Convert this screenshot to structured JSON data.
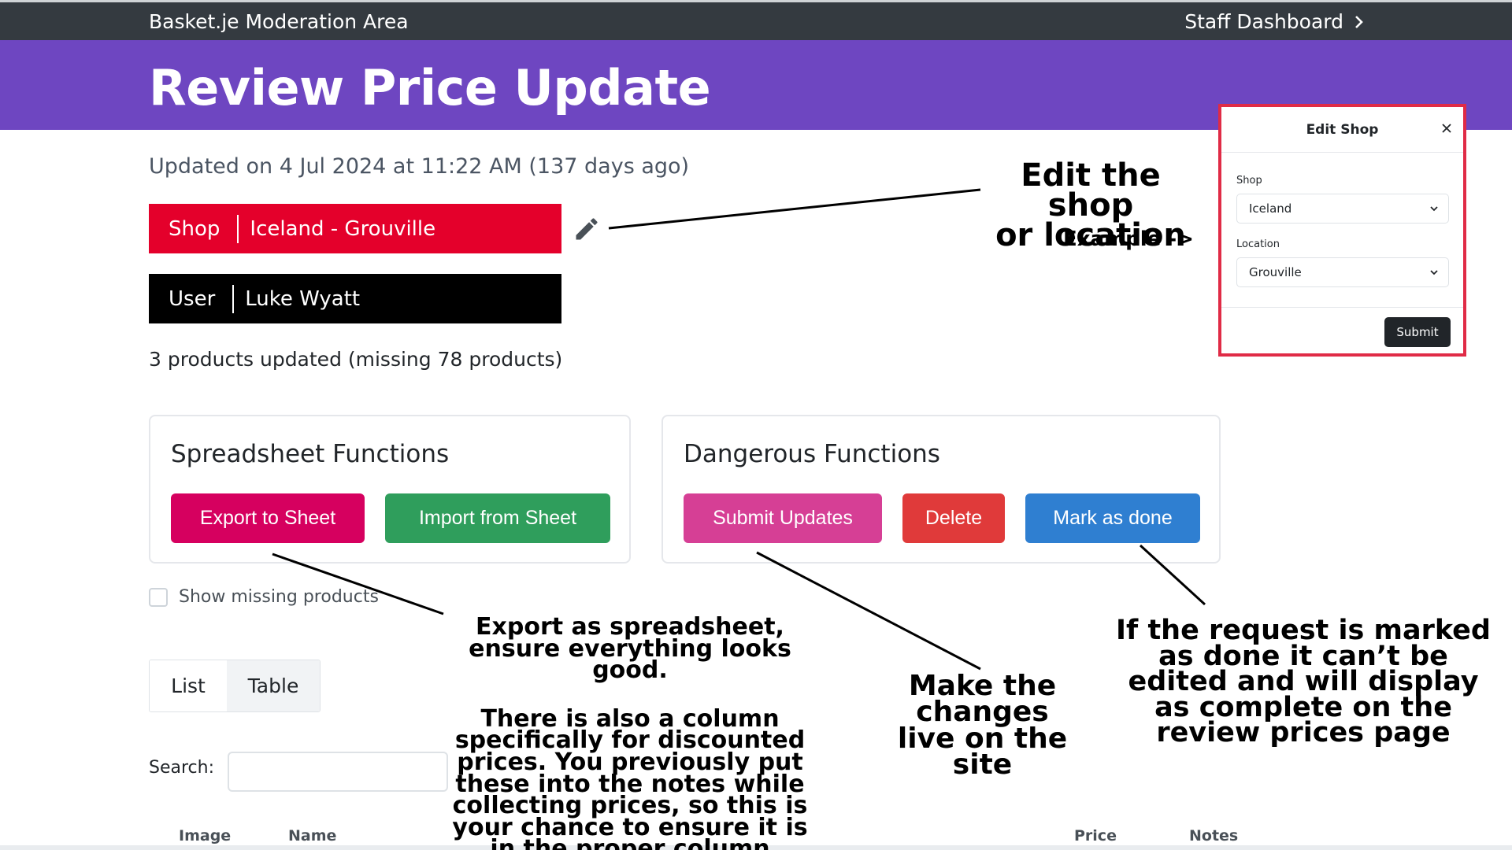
{
  "topbar": {
    "brand": "Basket.je Moderation Area",
    "staff_link": "Staff Dashboard",
    "staff_icon": "chevron-right-icon"
  },
  "page": {
    "title": "Review Price Update",
    "updated": "Updated on 4 Jul 2024 at 11:22 AM (137 days ago)",
    "shop_key": "Shop",
    "shop_value": "Iceland - Grouville",
    "user_key": "User",
    "user_value": "Luke Wyatt",
    "count": "3 products updated (missing 78 products)",
    "edit_icon": "pencil-icon"
  },
  "spreadsheet": {
    "title": "Spreadsheet Functions",
    "export_label": "Export to Sheet",
    "import_label": "Import from Sheet"
  },
  "dangerous": {
    "title": "Dangerous Functions",
    "submit_label": "Submit Updates",
    "delete_label": "Delete",
    "done_label": "Mark as done"
  },
  "filters": {
    "show_missing": "Show missing products",
    "show_missing_checked": false,
    "view_list": "List",
    "view_table": "Table",
    "active_view": "Table",
    "search_label": "Search:",
    "search_value": ""
  },
  "table": {
    "headers": [
      "Image",
      "Name",
      "Price",
      "Notes"
    ]
  },
  "modal": {
    "title": "Edit Shop",
    "shop_label": "Shop",
    "shop_value": "Iceland",
    "location_label": "Location",
    "location_value": "Grouville",
    "submit_label": "Submit"
  },
  "annotations": {
    "edit_line1": "Edit the shop",
    "edit_line2": "or location",
    "example": "Example ->",
    "export_para1": "Export as spreadsheet, ensure everything looks good.",
    "export_para2": "There is also a column specifically for discounted prices. You previously put these into the notes while collecting prices, so this is your chance to ensure it is in the proper column",
    "live": "Make the changes live on the site",
    "done": "If the request is marked as done it can’t be edited and will display as complete on the review prices page"
  },
  "colors": {
    "topbar": "#343a40",
    "hero": "#6e46c1",
    "shop_badge": "#e4002b",
    "export_btn": "#d6005f",
    "import_btn": "#2f9e5c",
    "submit_btn": "#d63f95",
    "delete_btn": "#e03a3a",
    "done_btn": "#2f7fd1",
    "modal_border": "#e02b46"
  }
}
